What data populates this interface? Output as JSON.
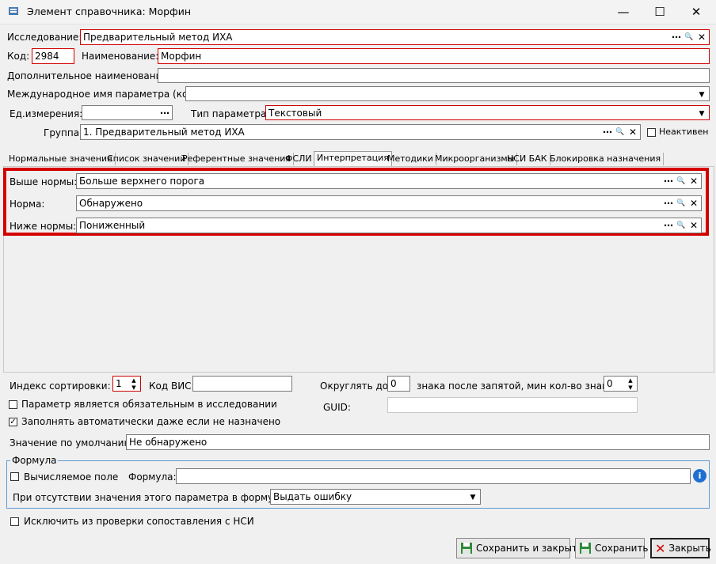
{
  "window": {
    "title": "Элемент справочника: Морфин",
    "minimize": "—",
    "maximize": "☐",
    "close": "✕"
  },
  "icons": {
    "dots": "⋯",
    "search": "🔍",
    "clear": "✕",
    "arrow": "▼",
    "spin_up": "▲",
    "spin_down": "▼",
    "check": "✓",
    "info": "i"
  },
  "form": {
    "study_label": "Исследование:",
    "study_value": "Предварительный метод ИХА",
    "code_label": "Код:",
    "code_value": "2984",
    "name_label": "Наименование:",
    "name_value": "Морфин",
    "add_name_label": "Дополнительное наименование:",
    "add_name_value": "",
    "intl_name_label": "Международное имя параметра (код):",
    "intl_name_value": "",
    "unit_label": "Ед.измерения:",
    "unit_value": "",
    "param_type_label": "Тип параметра:",
    "param_type_value": "Текстовый",
    "group_label": "Группа:",
    "group_value": "1. Предварительный метод ИХА",
    "inactive_label": "Неактивен"
  },
  "tabs": [
    "Нормальные значения",
    "Список значений",
    "Референтные значения",
    "ФСЛИ",
    "Интерпретация",
    "Методики",
    "Микроорганизмы",
    "НСИ БАК",
    "Блокировка назначения"
  ],
  "active_tab": "Интерпретация",
  "interpretation": {
    "above_label": "Выше нормы:",
    "above_value": "Больше верхнего порога",
    "norm_label": "Норма:",
    "norm_value": "Обнаружено",
    "below_label": "Ниже нормы:",
    "below_value": "Пониженный"
  },
  "bottom": {
    "sort_label": "Индекс сортировки:",
    "sort_value": "1",
    "vis_label": "Код ВИС:",
    "vis_value": "",
    "round_label": "Округлять до",
    "round_value": "0",
    "decimals_label": "знака после запятой, мин кол-во знаков",
    "decimals_value": "0",
    "required_label": "Параметр является обязательным в исследовании",
    "guid_label": "GUID:",
    "guid_value": "",
    "autofill_label": "Заполнять автоматически даже если не назначено",
    "default_label": "Значение по умолчанию:",
    "default_value": "Не обнаружено"
  },
  "formula": {
    "legend": "Формула",
    "computed_label": "Вычисляемое поле",
    "formula_label": "Формула:",
    "formula_value": "",
    "missing_label": "При отсутствии значения этого параметра в формуле:",
    "missing_value": "Выдать ошибку"
  },
  "exclude_label": "Исключить из проверки сопоставления с НСИ",
  "buttons": {
    "save_close": "Сохранить и закрыть",
    "save": "Сохранить",
    "close": "Закрыть"
  },
  "colors": {
    "required_border": "#d00000",
    "highlight": "#d40000",
    "fieldset_border": "#5b9bd5"
  }
}
